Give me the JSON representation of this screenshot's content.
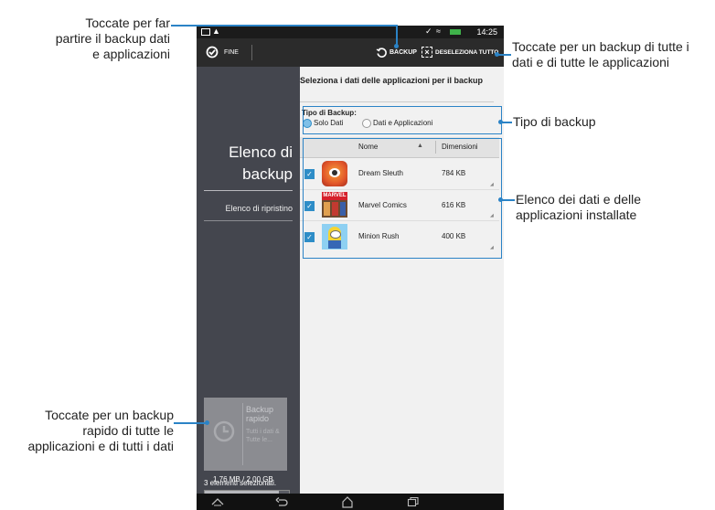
{
  "statusbar": {
    "time": "14:25"
  },
  "actionbar": {
    "done_label": "FINE",
    "backup_label": "BACKUP",
    "deselect_all_label": "DESELEZIONA TUTTO"
  },
  "sidebar": {
    "title_line1": "Elenco di",
    "title_line2": "backup",
    "restore_list_label": "Elenco di ripristino",
    "quick_backup": {
      "title": "Backup rapido",
      "subtitle": "Tutti i dati & Tutte le..."
    },
    "selected_count": "3 elementi selezionati.",
    "storage_used": "1,76 MB / 2,00 GB",
    "storage_fraction": 0.88
  },
  "content": {
    "heading": "Seleziona i dati delle applicazioni per il backup",
    "backup_type_label": "Tipo di Backup:",
    "options": {
      "data_only": "Solo Dati",
      "data_and_apps": "Dati e Applicazioni"
    },
    "selected_option": "data_only",
    "columns": {
      "name": "Nome",
      "size": "Dimensioni"
    },
    "apps": [
      {
        "name": "Dream Sleuth",
        "size": "784 KB",
        "icon": "dream-sleuth-icon"
      },
      {
        "name": "Marvel Comics",
        "size": "616 KB",
        "icon": "marvel-comics-icon"
      },
      {
        "name": "Minion Rush",
        "size": "400 KB",
        "icon": "minion-rush-icon"
      }
    ]
  },
  "annotations": {
    "backup_btn": [
      "Toccate per far",
      "partire il backup dati",
      "e applicazioni"
    ],
    "deselect_all": [
      "Toccate per un backup di tutte i",
      "dati e di tutte le applicazioni"
    ],
    "backup_type": [
      "Tipo di backup"
    ],
    "app_list": [
      "Elenco dei dati e delle",
      "applicazioni installate"
    ],
    "quick_backup": [
      "Toccate per un backup",
      "rapido di tutte le",
      "applicazioni e di tutti i dati"
    ]
  },
  "colors": {
    "accent": "#2b83c6",
    "sidebar": "#44464e",
    "checkbox": "#2e8dc7"
  }
}
